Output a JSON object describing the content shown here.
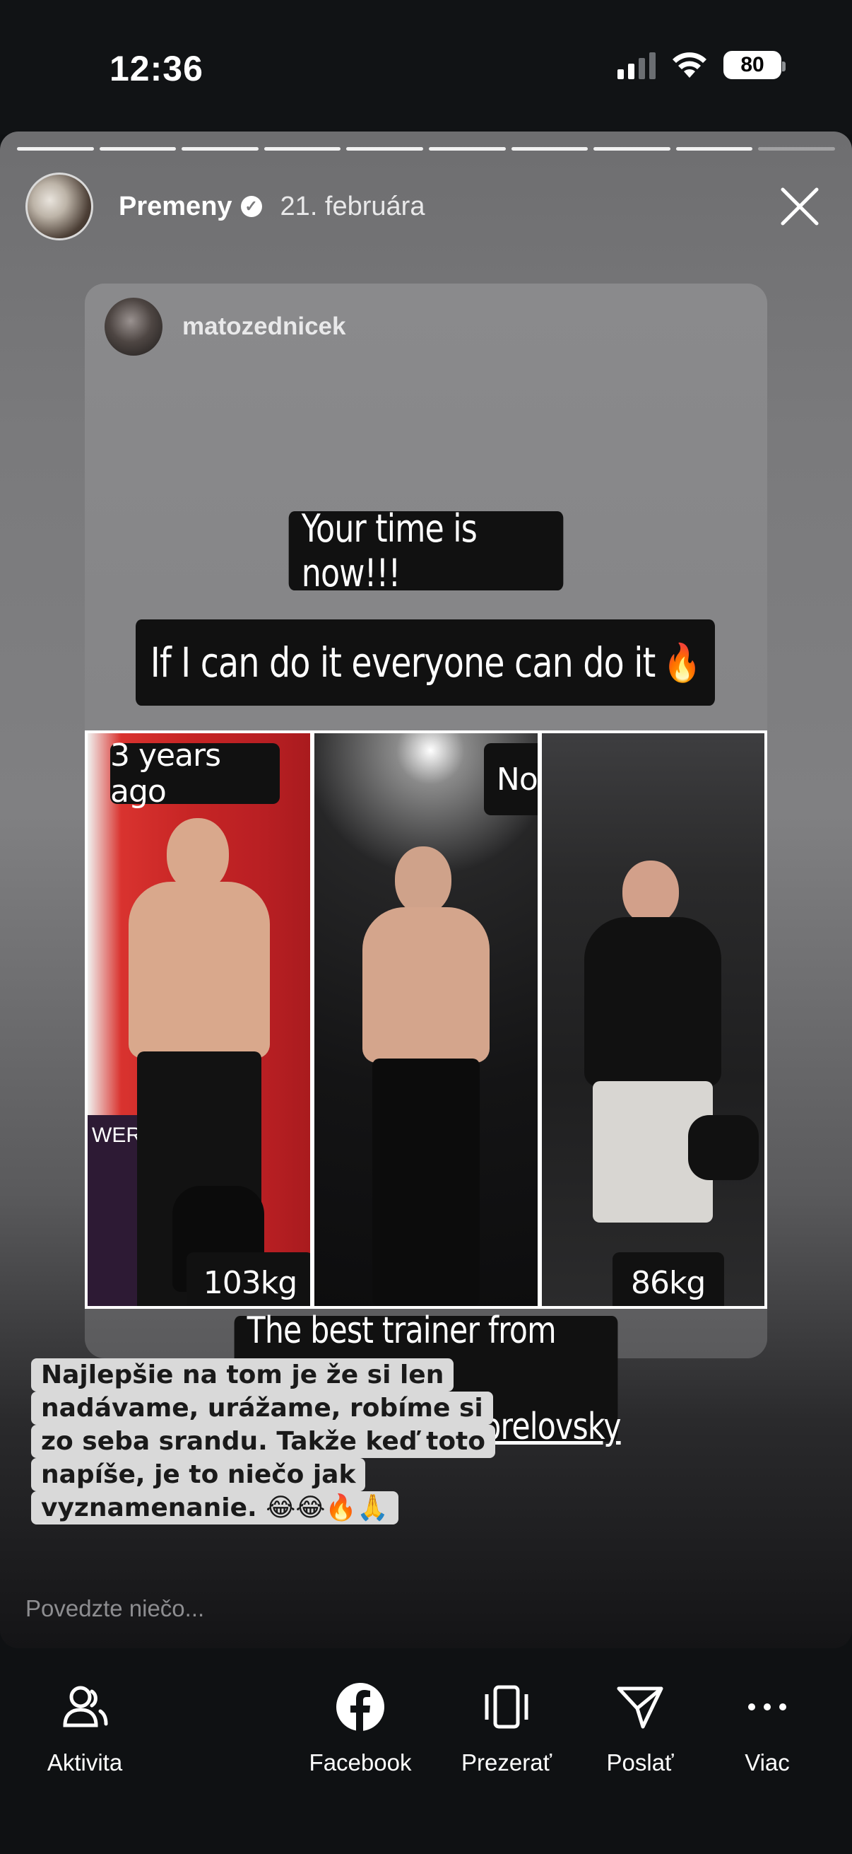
{
  "status_bar": {
    "time": "12:36",
    "battery": "80"
  },
  "story": {
    "account_name": "Premeny",
    "date": "21. februára",
    "progress_segments": 10,
    "shared_post": {
      "author": "matozednicek",
      "caption_1": "Your time is now!!!",
      "caption_2": "If I can do it everyone can do it",
      "caption_2_emoji": "🔥",
      "photo_labels": {
        "before_title": "3 years ago",
        "now_title": "Now",
        "before_weight": "103kg",
        "after_weight": "86kg"
      },
      "poster_text": "WER",
      "trainer_line": "The best trainer from Trnava",
      "trainer_handle": "@fitcoach_dominprelovsky"
    },
    "reply_lines": [
      "Najlepšie na tom je že si len",
      "nadávame, urážame, robíme si",
      "zo seba srandu. Takže keď toto",
      "napíše, je to niečo jak",
      "vyznamenanie. 😂😂🔥🙏"
    ],
    "reply_placeholder": "Povedzte niečo..."
  },
  "bottom_nav": {
    "activity": "Aktivita",
    "facebook": "Facebook",
    "view": "Prezerať",
    "send": "Poslať",
    "more": "Viac"
  }
}
